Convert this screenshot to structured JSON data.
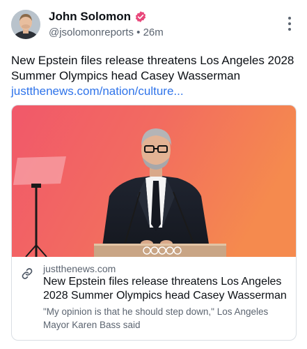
{
  "author": {
    "name": "John Solomon",
    "handle": "@jsolomonreports",
    "separator": "•",
    "time": "26m",
    "verified_color": "#e8477a"
  },
  "post": {
    "text": "New Epstein files release threatens Los Angeles 2028 Summer Olympics head Casey Wasserman",
    "link_text": "justthenews.com/nation/culture...",
    "link_color": "#2f74ea"
  },
  "card": {
    "domain": "justthenews.com",
    "title": "New Epstein files release threatens Los Angeles 2028 Summer Olympics head Casey Wasserman",
    "description": "\"My opinion is that he should step down,\" Los Angeles Mayor Karen Bass said"
  },
  "icons": {
    "menu": "more-vertical-icon",
    "verified": "verified-badge-icon",
    "link": "link-icon"
  }
}
